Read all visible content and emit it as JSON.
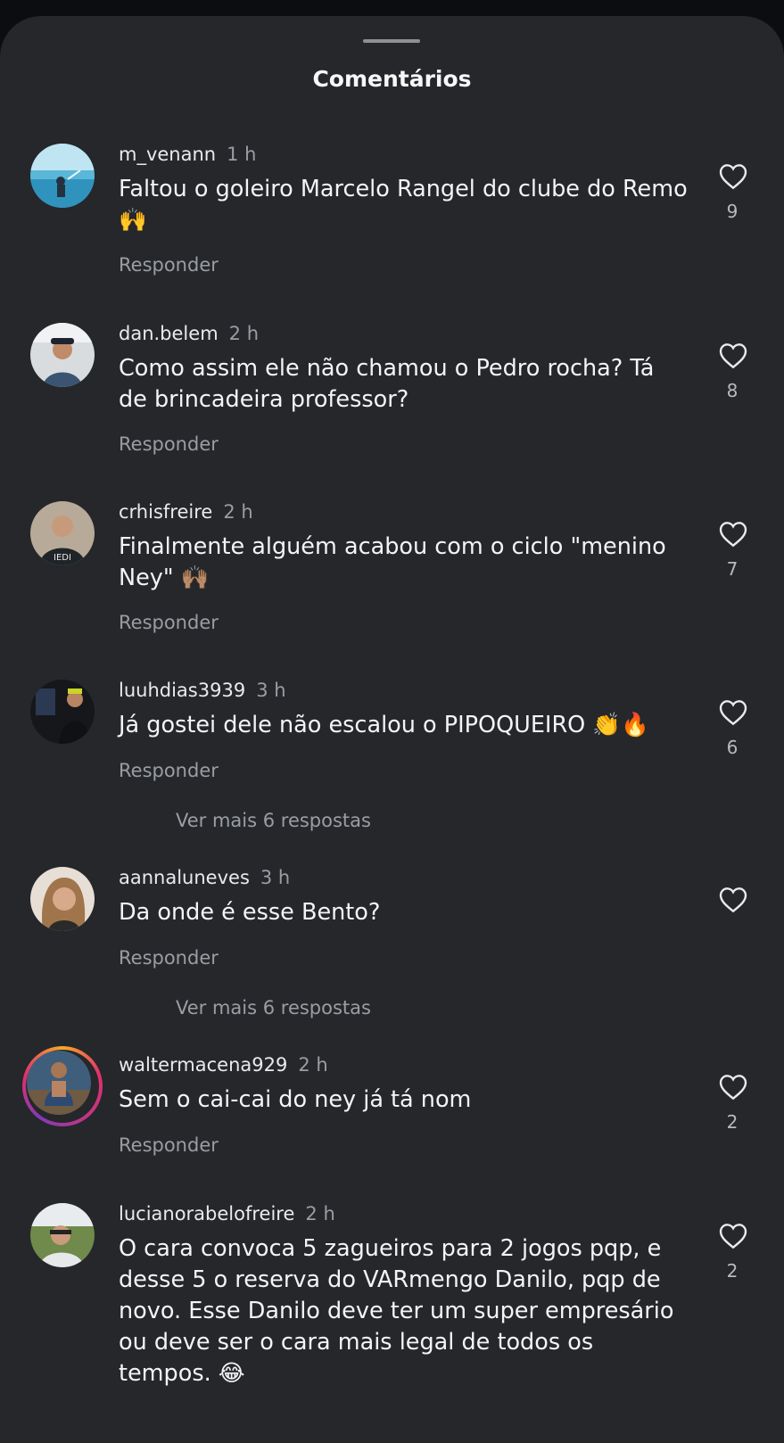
{
  "header": {
    "title": "Comentários"
  },
  "reply_label": "Responder",
  "comments": [
    {
      "username": "m_venann",
      "time": "1 h",
      "text": "Faltou o goleiro Marcelo Rangel do clube do Remo 🙌",
      "likes": "9"
    },
    {
      "username": "dan.belem",
      "time": "2 h",
      "text": "Como assim ele não chamou o Pedro rocha? Tá de brincadeira professor?",
      "likes": "8"
    },
    {
      "username": "crhisfreire",
      "time": "2 h",
      "text": "Finalmente alguém acabou com o ciclo \"menino Ney\" 🙌🏽",
      "likes": "7"
    },
    {
      "username": "luuhdias3939",
      "time": "3 h",
      "text": "Já gostei dele não escalou o PIPOQUEIRO 👏🔥",
      "likes": "6",
      "more_replies": "Ver mais 6 respostas"
    },
    {
      "username": "aannaluneves",
      "time": "3 h",
      "text": "Da onde é esse Bento?",
      "likes": "",
      "more_replies": "Ver mais 6 respostas"
    },
    {
      "username": "waltermacena929",
      "time": "2 h",
      "text": "Sem o cai-cai do ney já tá nom",
      "likes": "2"
    },
    {
      "username": "lucianorabelofreire",
      "time": "2 h",
      "text": "O cara convoca 5 zagueiros para 2 jogos pqp, e desse 5 o reserva do VARmengo Danilo, pqp de novo. Esse Danilo deve ter um super empresário ou deve ser o cara mais legal de todos os tempos. 😂",
      "likes": "2"
    }
  ],
  "icons": {
    "like": "heart-outline-icon",
    "story_ring": "story-ring"
  },
  "colors": {
    "background": "#25272b",
    "muted": "#9a9da2"
  }
}
